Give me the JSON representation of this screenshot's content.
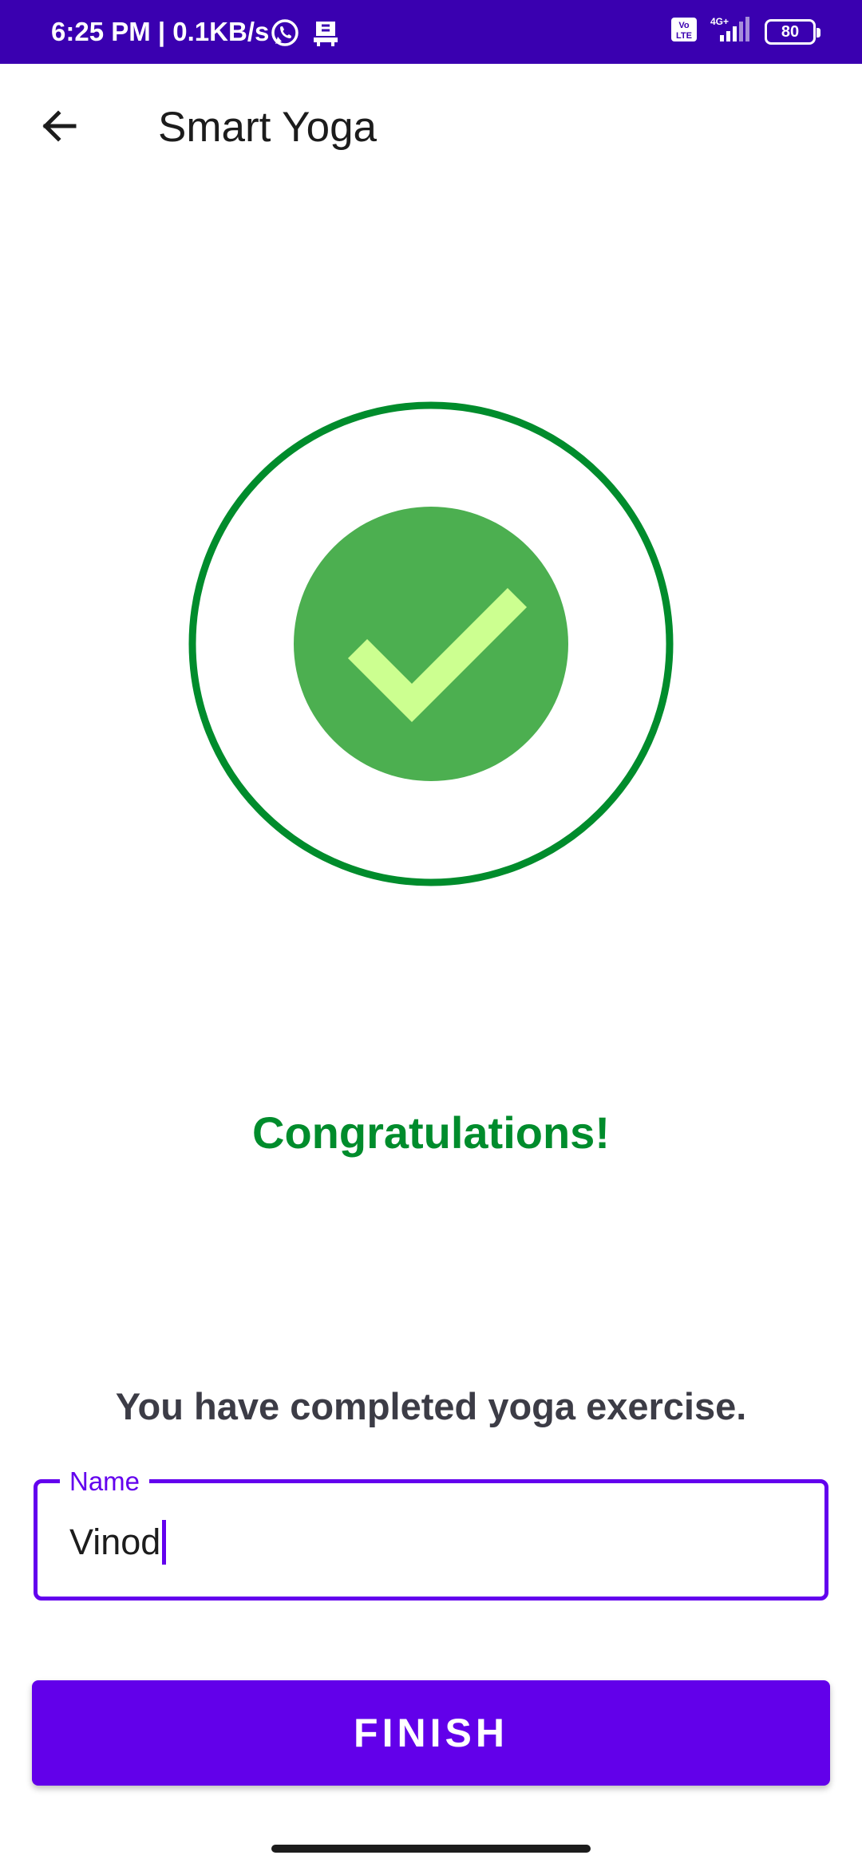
{
  "status_bar": {
    "time": "6:25 PM | 0.1KB/s",
    "network": "4G+",
    "volte": "Vo LTE",
    "battery": "80",
    "background_color": "#3a00b0"
  },
  "app_bar": {
    "title": "Smart Yoga",
    "back_icon": "arrow-left-icon"
  },
  "success": {
    "icon": "check-circle-icon",
    "ring_color": "#008c2c",
    "disc_color": "#4caf50",
    "check_color": "#ccff90",
    "heading": "Congratulations!",
    "message": "You have completed yoga exercise."
  },
  "name_field": {
    "label": "Name",
    "value": "Vinod",
    "focused": true,
    "accent_color": "#6300ee"
  },
  "finish_button": {
    "label": "FINISH",
    "color": "#6200ea"
  }
}
